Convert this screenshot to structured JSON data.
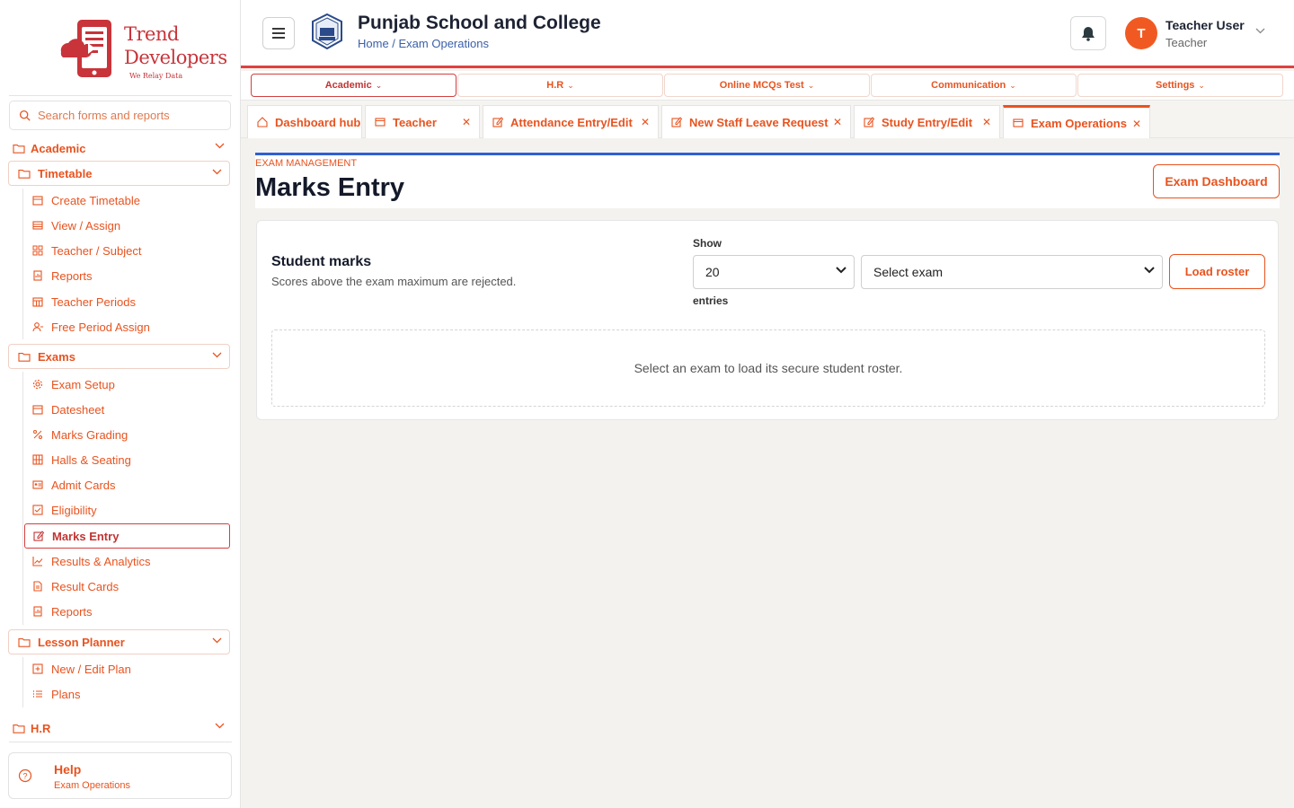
{
  "brand": {
    "line1": "Trend",
    "line2": "Developers",
    "tagline": "We Relay Data"
  },
  "search": {
    "placeholder": "Search forms and reports"
  },
  "sidebar": {
    "academic": "Academic",
    "timetable": {
      "label": "Timetable",
      "items": [
        "Create Timetable",
        "View / Assign",
        "Teacher / Subject",
        "Reports",
        "Teacher Periods",
        "Free Period Assign"
      ]
    },
    "exams": {
      "label": "Exams",
      "items": [
        "Exam Setup",
        "Datesheet",
        "Marks Grading",
        "Halls & Seating",
        "Admit Cards",
        "Eligibility",
        "Marks Entry",
        "Results & Analytics",
        "Result Cards",
        "Reports"
      ]
    },
    "lesson_planner": {
      "label": "Lesson Planner",
      "items": [
        "New / Edit Plan",
        "Plans"
      ]
    },
    "hr": "H.R",
    "help": {
      "title": "Help",
      "subtitle": "Exam Operations"
    }
  },
  "header": {
    "school": "Punjab School and College",
    "breadcrumb": "Home / Exam Operations",
    "user": {
      "initial": "T",
      "name": "Teacher User",
      "role": "Teacher"
    }
  },
  "topmenu": [
    "Academic",
    "H.R",
    "Online MCQs Test",
    "Communication",
    "Settings"
  ],
  "tabs": [
    "Dashboard hub",
    "Teacher",
    "Attendance Entry/Edit",
    "New Staff Leave Request",
    "Study Entry/Edit",
    "Exam Operations"
  ],
  "page": {
    "eyebrow": "EXAM MANAGEMENT",
    "title": "Marks Entry",
    "dashboard_button": "Exam Dashboard"
  },
  "card": {
    "title": "Student marks",
    "subtitle": "Scores above the exam maximum are rejected.",
    "show_label": "Show",
    "entries_label": "entries",
    "page_size": "20",
    "exam_select": "Select exam",
    "load_button": "Load roster",
    "empty_message": "Select an exam to load its secure student roster."
  },
  "colors": {
    "accent": "#e8531f",
    "brand_red": "#c8343a",
    "header_rule": "#e04040",
    "title_rule": "#2f5fd6"
  }
}
